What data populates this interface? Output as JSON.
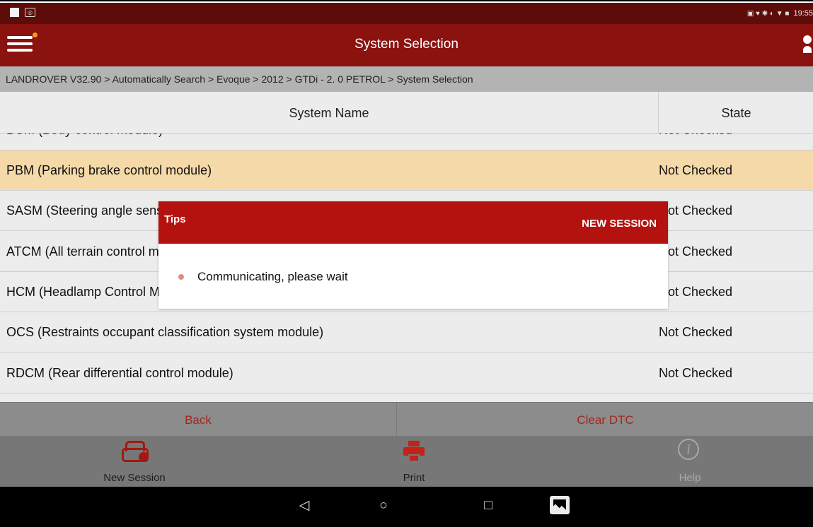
{
  "status_bar": {
    "time": "19:55"
  },
  "header": {
    "title": "System Selection"
  },
  "breadcrumb": "LANDROVER V32.90 > Automatically Search > Evoque > 2012 > GTDi - 2. 0 PETROL > System Selection",
  "table": {
    "headers": {
      "name": "System Name",
      "state": "State"
    },
    "rows": [
      {
        "name": "BCM (Body control module)",
        "state": "Not Checked"
      },
      {
        "name": "PBM (Parking brake control module)",
        "state": "Not Checked"
      },
      {
        "name": "SASM (Steering angle sensor module)",
        "state": "Not Checked"
      },
      {
        "name": "ATCM (All terrain control module)",
        "state": "Not Checked"
      },
      {
        "name": "HCM (Headlamp Control Module)",
        "state": "Not Checked"
      },
      {
        "name": "OCS (Restraints occupant classification system module)",
        "state": "Not Checked"
      },
      {
        "name": "RDCM (Rear differential control module)",
        "state": "Not Checked"
      }
    ]
  },
  "actions": {
    "back": "Back",
    "clear_dtc": "Clear DTC"
  },
  "toolbar": {
    "new_session": "New Session",
    "print": "Print",
    "help": "Help"
  },
  "modal": {
    "title": "Tips",
    "button": "NEW SESSION",
    "message": "Communicating, please wait"
  },
  "colors": {
    "header": "#8a120f",
    "modal_header": "#b4120f",
    "selected_row": "#f5d9a8",
    "action_text": "#a0271f"
  },
  "icons": [
    "menu-icon",
    "user-icon",
    "car-icon",
    "printer-icon",
    "info-icon",
    "back-nav-icon",
    "home-nav-icon",
    "recent-apps-icon",
    "gallery-icon"
  ]
}
